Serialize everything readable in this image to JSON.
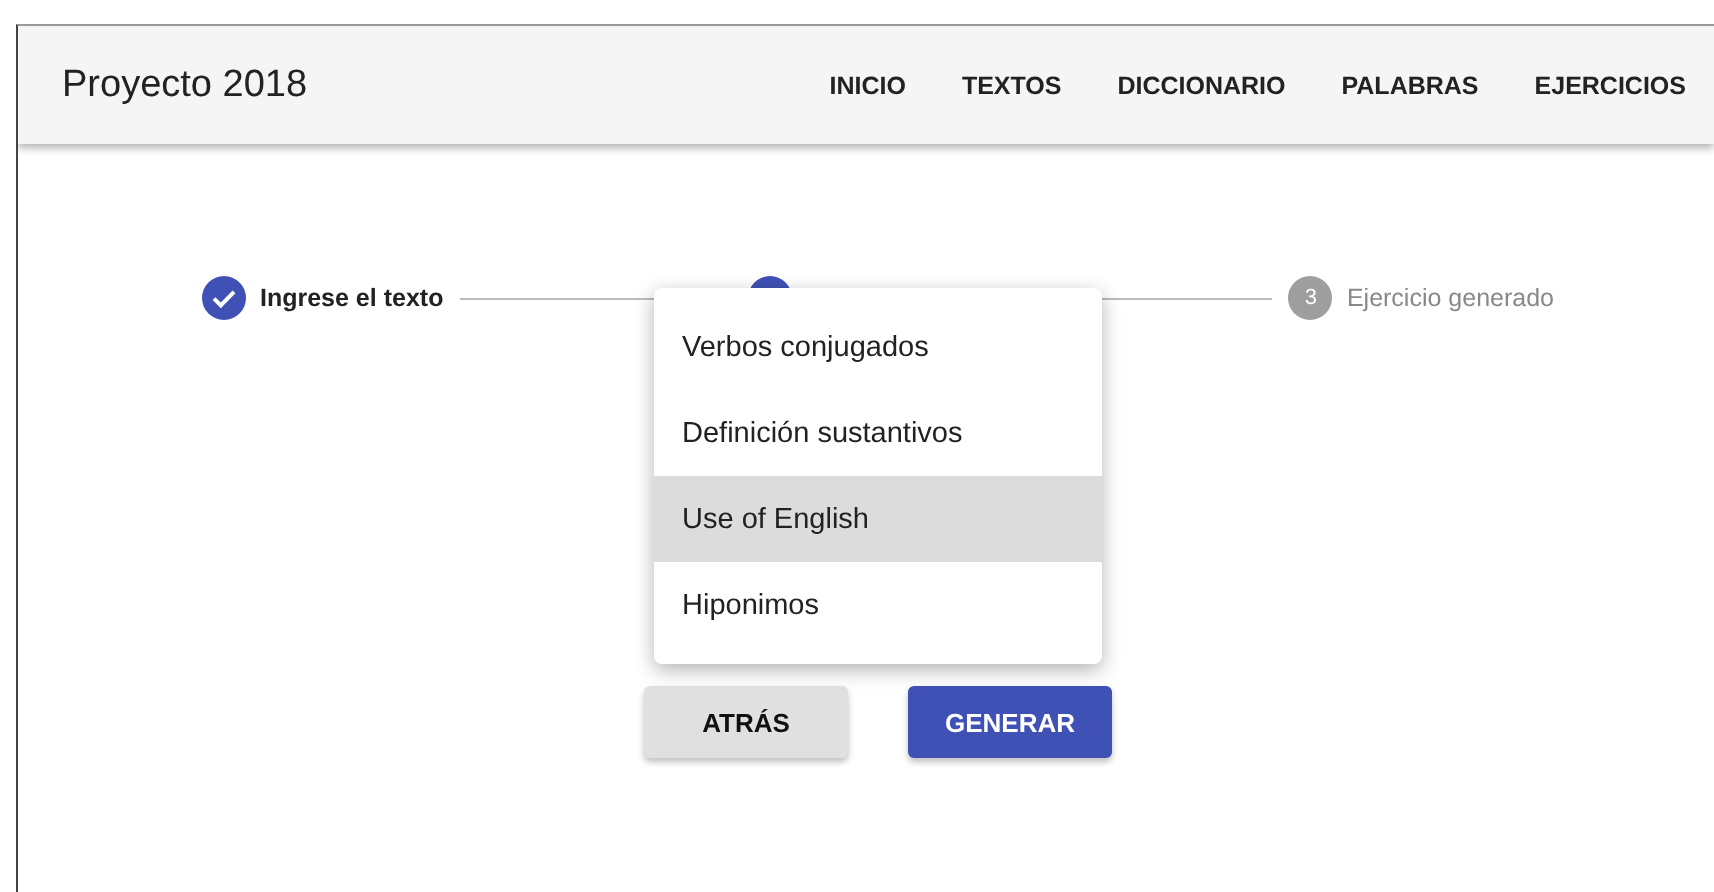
{
  "app_bar": {
    "title": "Proyecto 2018",
    "nav": [
      {
        "label": "INICIO"
      },
      {
        "label": "TEXTOS"
      },
      {
        "label": "DICCIONARIO"
      },
      {
        "label": "PALABRAS"
      },
      {
        "label": "EJERCICIOS"
      }
    ]
  },
  "stepper": [
    {
      "kind": "completed",
      "label": "Ingrese el texto"
    },
    {
      "kind": "active"
    },
    {
      "kind": "pending",
      "number": "3",
      "label": "Ejercicio generado"
    }
  ],
  "menu": [
    {
      "label": "Verbos conjugados",
      "selected": false
    },
    {
      "label": "Definición sustantivos",
      "selected": false
    },
    {
      "label": "Use of English",
      "selected": true
    },
    {
      "label": "Hiponimos",
      "selected": false
    }
  ],
  "buttons": [
    {
      "kind": "secondary",
      "label": "ATRÁS"
    },
    {
      "kind": "primary",
      "label": "GENERAR"
    }
  ]
}
